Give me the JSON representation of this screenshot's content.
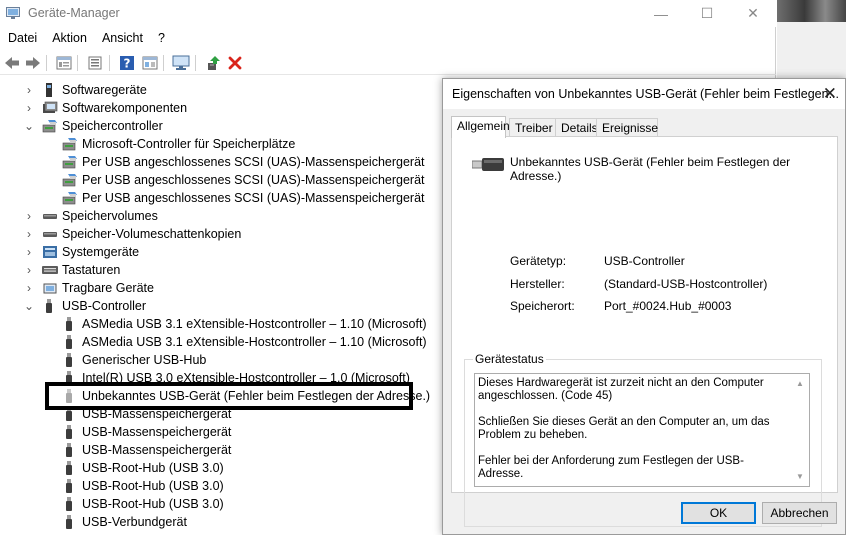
{
  "window": {
    "title": "Geräte-Manager",
    "minimize": "—",
    "maximize": "☐",
    "close": "✕"
  },
  "menu": [
    "Datei",
    "Aktion",
    "Ansicht",
    "?"
  ],
  "toolbar": {
    "icons": [
      "back-icon",
      "forward-icon",
      "properties-icon",
      "list-icon",
      "help-icon",
      "show-hidden-icon",
      "monitor-icon",
      "update-driver-icon",
      "uninstall-icon"
    ],
    "uninstall_color": "#d9251c",
    "update_color": "#2fa043"
  },
  "tree": [
    {
      "label": "Softwaregeräte",
      "level": 0,
      "expander": "›",
      "icon": "software-device-icon"
    },
    {
      "label": "Softwarekomponenten",
      "level": 0,
      "expander": "›",
      "icon": "software-component-icon"
    },
    {
      "label": "Speichercontroller",
      "level": 0,
      "expander": "⌄",
      "icon": "storage-controller-icon"
    },
    {
      "label": "Microsoft-Controller für Speicherplätze",
      "level": 1,
      "expander": "",
      "icon": "storage-controller-icon"
    },
    {
      "label": "Per USB angeschlossenes SCSI (UAS)-Massenspeichergerät",
      "level": 1,
      "expander": "",
      "icon": "storage-controller-icon"
    },
    {
      "label": "Per USB angeschlossenes SCSI (UAS)-Massenspeichergerät",
      "level": 1,
      "expander": "",
      "icon": "storage-controller-icon"
    },
    {
      "label": "Per USB angeschlossenes SCSI (UAS)-Massenspeichergerät",
      "level": 1,
      "expander": "",
      "icon": "storage-controller-icon"
    },
    {
      "label": "Speichervolumes",
      "level": 0,
      "expander": "›",
      "icon": "volume-icon"
    },
    {
      "label": "Speicher-Volumeschattenkopien",
      "level": 0,
      "expander": "›",
      "icon": "volume-icon"
    },
    {
      "label": "Systemgeräte",
      "level": 0,
      "expander": "›",
      "icon": "system-device-icon"
    },
    {
      "label": "Tastaturen",
      "level": 0,
      "expander": "›",
      "icon": "keyboard-icon"
    },
    {
      "label": "Tragbare Geräte",
      "level": 0,
      "expander": "›",
      "icon": "portable-device-icon"
    },
    {
      "label": "USB-Controller",
      "level": 0,
      "expander": "⌄",
      "icon": "usb-icon"
    },
    {
      "label": "ASMedia USB 3.1 eXtensible-Hostcontroller – 1.10 (Microsoft)",
      "level": 1,
      "expander": "",
      "icon": "usb-icon"
    },
    {
      "label": "ASMedia USB 3.1 eXtensible-Hostcontroller – 1.10 (Microsoft)",
      "level": 1,
      "expander": "",
      "icon": "usb-icon"
    },
    {
      "label": "Generischer USB-Hub",
      "level": 1,
      "expander": "",
      "icon": "usb-icon"
    },
    {
      "label": "Intel(R) USB 3.0 eXtensible-Hostcontroller – 1.0 (Microsoft)",
      "level": 1,
      "expander": "",
      "icon": "usb-icon"
    },
    {
      "label": "Unbekanntes USB-Gerät (Fehler beim Festlegen der Adresse.)",
      "level": 1,
      "expander": "",
      "icon": "usb-warning-icon"
    },
    {
      "label": "USB-Massenspeichergerät",
      "level": 1,
      "expander": "",
      "icon": "usb-icon"
    },
    {
      "label": "USB-Massenspeichergerät",
      "level": 1,
      "expander": "",
      "icon": "usb-icon"
    },
    {
      "label": "USB-Massenspeichergerät",
      "level": 1,
      "expander": "",
      "icon": "usb-icon"
    },
    {
      "label": "USB-Root-Hub (USB 3.0)",
      "level": 1,
      "expander": "",
      "icon": "usb-icon"
    },
    {
      "label": "USB-Root-Hub (USB 3.0)",
      "level": 1,
      "expander": "",
      "icon": "usb-icon"
    },
    {
      "label": "USB-Root-Hub (USB 3.0)",
      "level": 1,
      "expander": "",
      "icon": "usb-icon"
    },
    {
      "label": "USB-Verbundgerät",
      "level": 1,
      "expander": "",
      "icon": "usb-icon"
    }
  ],
  "dialog": {
    "title": "Eigenschaften von Unbekanntes USB-Gerät (Fehler beim Festlegen...",
    "close": "✕",
    "tabs": [
      "Allgemein",
      "Treiber",
      "Details",
      "Ereignisse"
    ],
    "device_name": "Unbekanntes USB-Gerät (Fehler beim Festlegen der Adresse.)",
    "properties": [
      {
        "label": "Gerätetyp:",
        "value": "USB-Controller"
      },
      {
        "label": "Hersteller:",
        "value": "(Standard-USB-Hostcontroller)"
      },
      {
        "label": "Speicherort:",
        "value": "Port_#0024.Hub_#0003"
      }
    ],
    "status_legend": "Gerätestatus",
    "status_paragraphs": [
      "Dieses Hardwaregerät ist zurzeit nicht an den Computer angeschlossen. (Code 45)",
      "Schließen Sie dieses Gerät an den Computer an, um das Problem zu beheben.",
      "Fehler bei der Anforderung zum Festlegen der USB-Adresse."
    ],
    "ok": "OK",
    "cancel": "Abbrechen"
  }
}
